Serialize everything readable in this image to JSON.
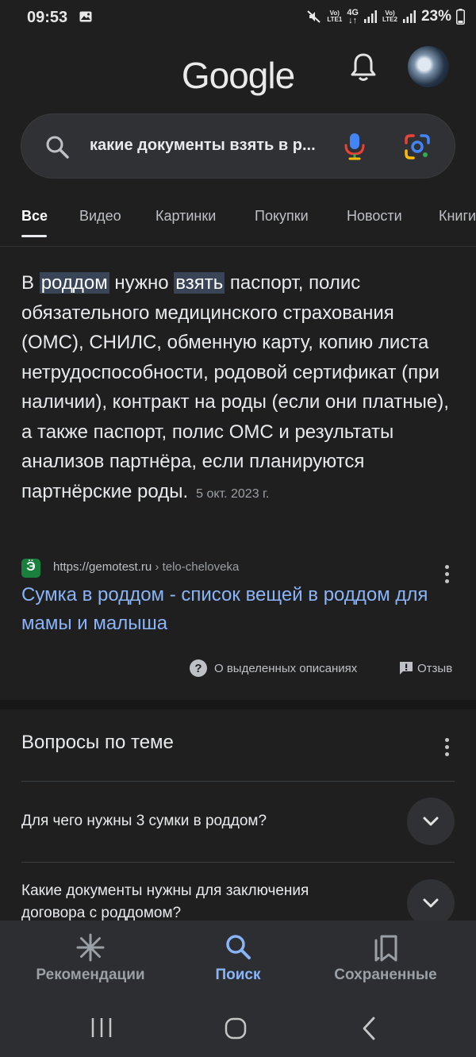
{
  "status_bar": {
    "time": "09:53",
    "sim1_top": "Vo)",
    "sim1_bottom": "LTE1",
    "net_type": "4G",
    "sim2_top": "Vo)",
    "sim2_bottom": "LTE2",
    "battery": "23%"
  },
  "header": {
    "logo": "Google"
  },
  "search": {
    "query": "какие документы взять в р..."
  },
  "tabs": [
    {
      "label": "Все",
      "active": true
    },
    {
      "label": "Видео"
    },
    {
      "label": "Картинки"
    },
    {
      "label": "Покупки"
    },
    {
      "label": "Новости"
    },
    {
      "label": "Книги"
    }
  ],
  "snippet": {
    "t1": "В ",
    "h1": "роддом",
    "t2": " нужно ",
    "h2": "взять",
    "t3": " паспорт, полис обязательного медицинского страхования (ОМС), СНИЛС, обменную карту, копию листа нетрудоспособности, родовой сертификат (при наличии), контракт на роды (если они платные), а также паспорт, полис ОМС и результаты анализов партнёра, если планируются партнёрские роды.",
    "date": "5 окт. 2023 г."
  },
  "source": {
    "favicon_letter": "Ӭ",
    "domain": "https://gemotest.ru",
    "path": " › telo-cheloveka"
  },
  "result": {
    "title": "Сумка в роддом - список вещей в роддом для мамы и малыша"
  },
  "featured_footer": {
    "about_label": "О выделенных описаниях",
    "feedback_label": "Отзыв"
  },
  "paa": {
    "title": "Вопросы по теме",
    "questions": [
      "Для чего нужны 3 сумки в роддом?",
      "Какие документы нужны для заключения договора с роддомом?"
    ]
  },
  "bottom_nav": [
    {
      "label": "Рекомендации"
    },
    {
      "label": "Поиск",
      "active": true
    },
    {
      "label": "Сохраненные"
    }
  ],
  "colors": {
    "background": "#1f1f1f",
    "link": "#8ab4f8",
    "highlight": "#394457",
    "nav_bg": "#2d2e31"
  }
}
